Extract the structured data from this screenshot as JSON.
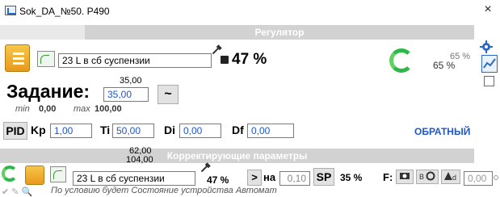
{
  "window": {
    "title": "Sok_DA_№50. P490",
    "close": "×"
  },
  "section_regulator": "Регулятор",
  "section_correction": "Корректирующие параметры",
  "sensor": {
    "name": "23 L в сб суспензии",
    "value": "47 %",
    "right_value": "65 %",
    "right_value_faded": "65 %"
  },
  "setpoint": {
    "label": "Задание:",
    "above": "35,00",
    "value": "35,00",
    "min_label": "min",
    "min_value": "0,00",
    "max_label": "max",
    "max_value": "100,00",
    "tilde": "~"
  },
  "pid": {
    "button": "PID",
    "kp_label": "Kp",
    "kp": "1,00",
    "ti_label": "Ti",
    "ti": "50,00",
    "di_label": "Di",
    "di": "0,00",
    "df_label": "Df",
    "df": "0,00",
    "mode": "ОБРАТНЫЙ"
  },
  "correction": {
    "top1": "62,00",
    "top2": "104,00",
    "sensor": "23 L в сб суспензии",
    "value": "47 %",
    "gt": ">",
    "na_label": "на",
    "na_value": "0,10",
    "sp_label": "SP",
    "sp_value": "35 %",
    "f_label": "F:",
    "f_value": "0,00"
  },
  "status": "По условию будет Состояние устройства Автомат",
  "colors": {
    "accent": "#1f56c9",
    "bar": "#d2d2d2",
    "green": "#2eb84a"
  },
  "icons": [
    "window-icon",
    "close-icon",
    "regulator-icon",
    "plot-icon",
    "pen-icon",
    "save-icon",
    "refresh-icon",
    "settings-icon",
    "trend-icon",
    "checkbox"
  ]
}
